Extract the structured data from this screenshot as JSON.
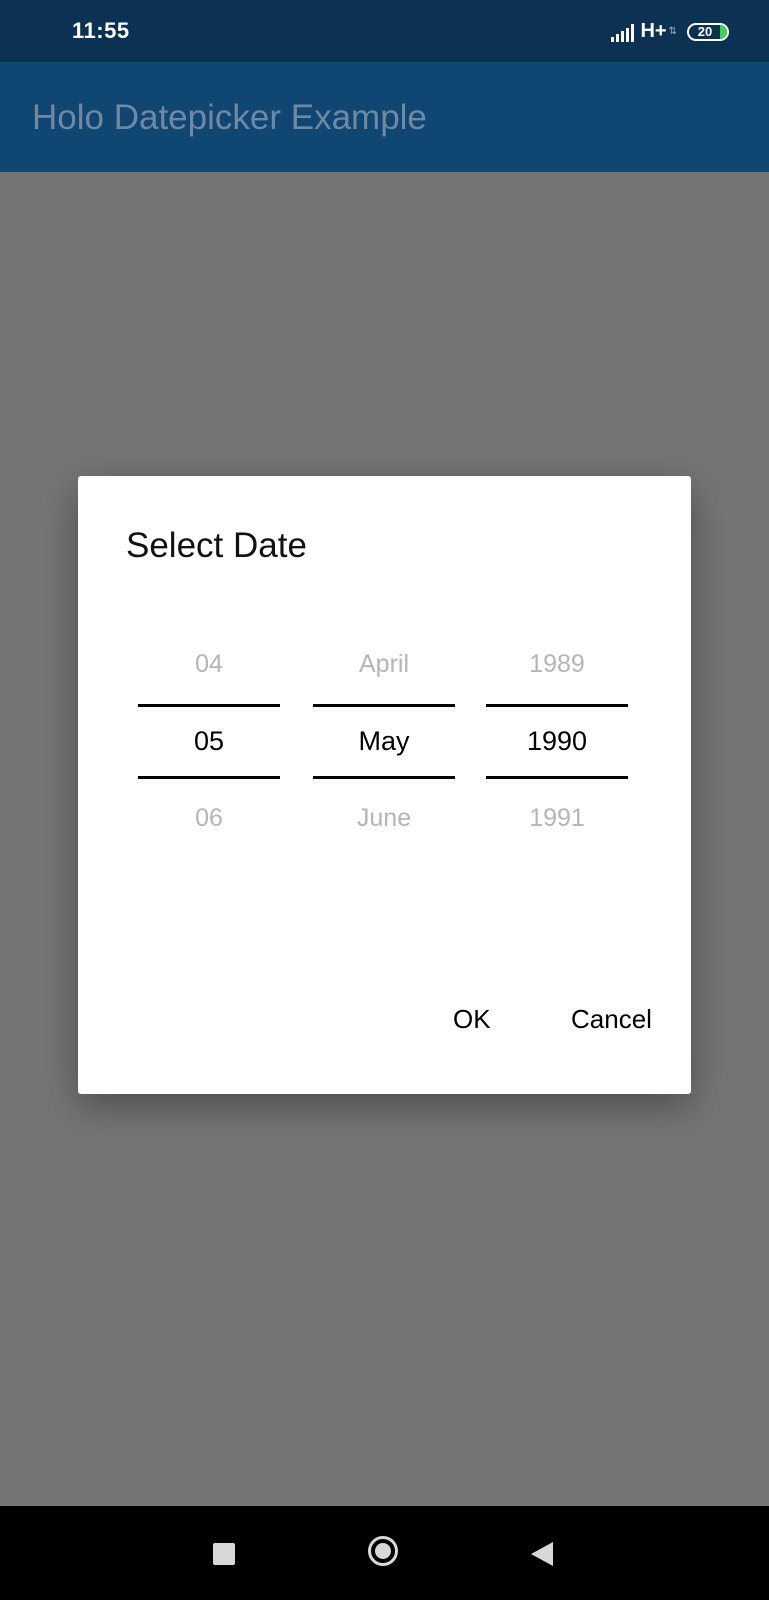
{
  "status_bar": {
    "time": "11:55",
    "network_type": "H+",
    "battery_level": "20",
    "icons": [
      "signal-icon",
      "battery-icon"
    ],
    "battery_fill_color": "#3fd34a"
  },
  "app_bar": {
    "title": "Holo Datepicker Example",
    "background_color": "#0f4672"
  },
  "dialog": {
    "title": "Select Date",
    "day_picker": {
      "previous": "04",
      "selected": "05",
      "next": "06"
    },
    "month_picker": {
      "previous": "April",
      "selected": "May",
      "next": "June"
    },
    "year_picker": {
      "previous": "1989",
      "selected": "1990",
      "next": "1991"
    },
    "ok_label": "OK",
    "cancel_label": "Cancel"
  },
  "nav_bar": {
    "icons": [
      "recent-apps-icon",
      "home-icon",
      "back-icon"
    ]
  }
}
